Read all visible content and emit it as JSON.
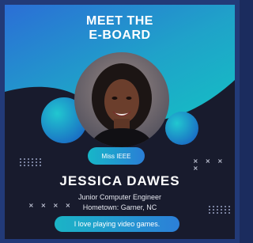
{
  "header": {
    "line1": "MEET THE",
    "line2": "E-BOARD"
  },
  "profile": {
    "position": "Miss IEEE",
    "name": "JESSICA DAWES",
    "role": "Junior Computer Engineer",
    "hometown": "Hometown: Garner, NC",
    "fun_fact": "I love playing video games."
  },
  "decor": {
    "x_marks_right": "× × × ×",
    "x_marks_left": "× × × ×"
  },
  "colors": {
    "background": "#181b2d",
    "accent_teal": "#17b6c8",
    "accent_blue": "#2a7ed6",
    "frame": "#223a78"
  }
}
